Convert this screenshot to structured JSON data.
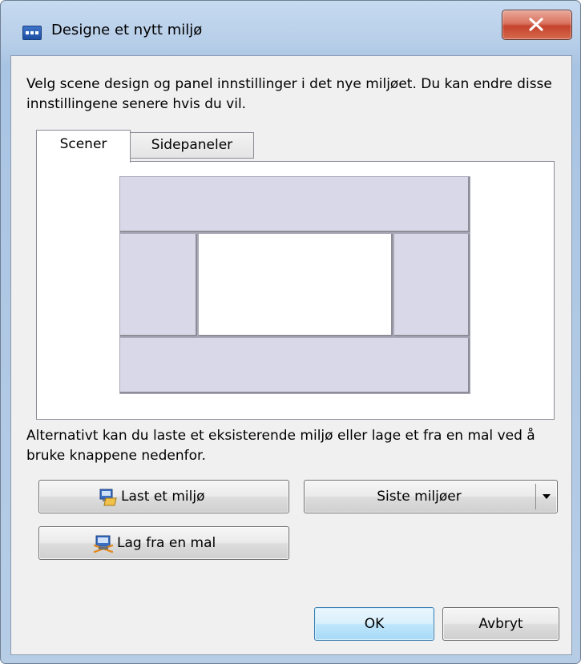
{
  "window": {
    "title": "Designe et nytt miljø"
  },
  "description": "Velg scene design og panel innstillinger i det nye miljøet. Du kan endre disse innstillingene senere hvis du vil.",
  "tabs": [
    {
      "label": "Scener",
      "active": true
    },
    {
      "label": "Sidepaneler",
      "active": false
    }
  ],
  "alternative_text": "Alternativt kan du laste et eksisterende miljø eller lage et fra en mal ved å bruke knappene nedenfor.",
  "buttons": {
    "load": "Last et miljø",
    "recent": "Siste miljøer",
    "template": "Lag fra en mal",
    "ok": "OK",
    "cancel": "Avbryt"
  },
  "colors": {
    "scene_region": "#d8d8e8",
    "close_button": "#c5432c",
    "ok_border": "#3c7fb1"
  },
  "icons": [
    "app-icon",
    "close-icon",
    "load-environment-icon",
    "dropdown-arrow-icon",
    "template-icon"
  ]
}
